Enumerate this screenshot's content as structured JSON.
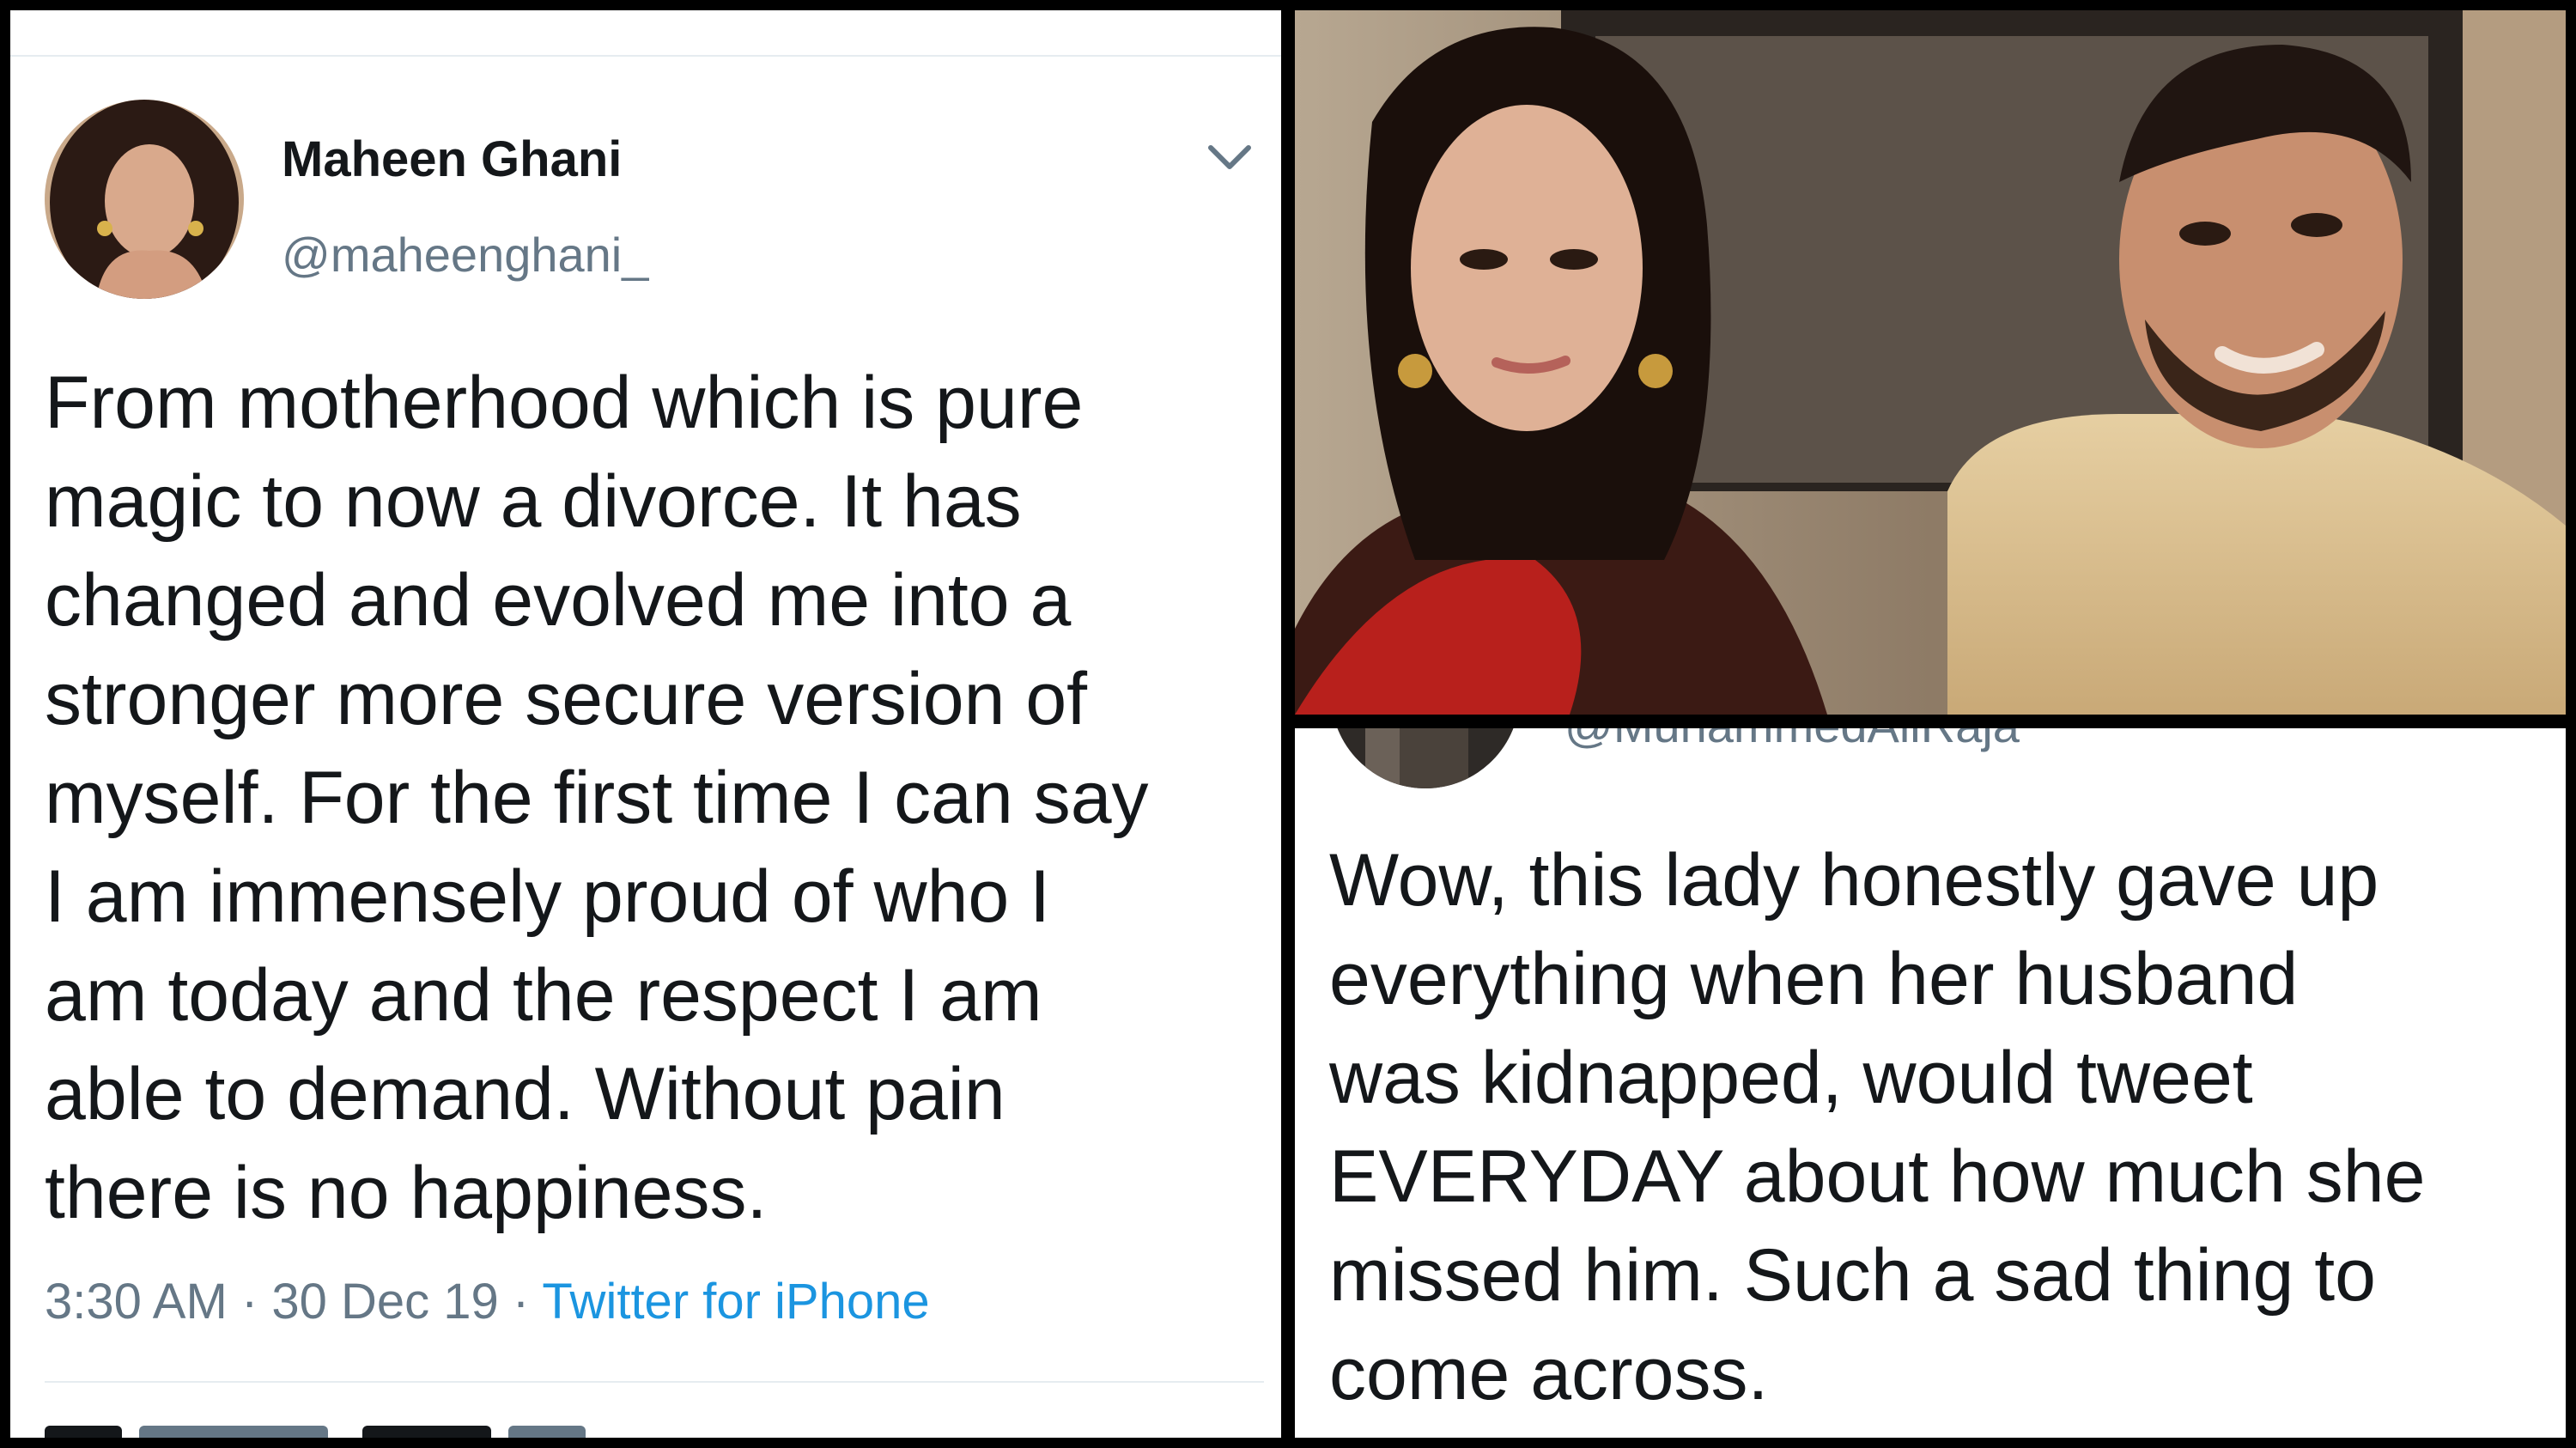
{
  "tweet": {
    "display_name": "Maheen Ghani",
    "handle": "@maheenghani_",
    "lines": [
      "From motherhood which is pure",
      "magic to now a divorce. It has",
      "changed and evolved me into a",
      "stronger more secure version of",
      "myself. For the first time I can say",
      "I am immensely proud of who I",
      "am today and the respect I am",
      "able to demand. Without pain",
      "there is no happiness."
    ],
    "time": "3:30 AM",
    "date": "30 Dec 19",
    "separator": "·",
    "source": "Twitter for iPhone",
    "icons": {
      "menu": "chevron-down-icon",
      "avatar": "avatar"
    },
    "colors": {
      "text": "#14171a",
      "secondary": "#657786",
      "link": "#1b95e0",
      "divider": "#e6ecf0"
    }
  },
  "reply": {
    "handle": "@MuhammedAliRaja",
    "lines": [
      "Wow, this lady honestly gave up",
      "everything when her husband",
      "was kidnapped, would tweet",
      "EVERYDAY about how much she",
      "missed him. Such a sad thing to",
      "come across."
    ]
  }
}
